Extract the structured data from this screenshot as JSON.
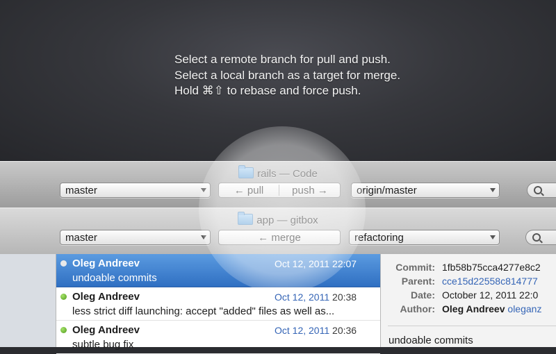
{
  "hint": {
    "line1": "Select a remote branch for pull and push.",
    "line2": "Select a local branch as a target for merge.",
    "line3": "Hold ⌘⇧ to rebase and force push."
  },
  "window1": {
    "title": "rails — Code",
    "local_branch": "master",
    "pull_label": "← pull",
    "push_label": "push →",
    "remote_branch": "origin/master"
  },
  "window2": {
    "title": "app — gitbox",
    "local_branch": "master",
    "merge_label": "← merge",
    "target_branch": "refactoring"
  },
  "commits": [
    {
      "author": "Oleg Andreev",
      "date": "Oct 12, 2011",
      "time": "22:07",
      "message": "undoable commits",
      "status": "selected"
    },
    {
      "author": "Oleg Andreev",
      "date": "Oct 12, 2011",
      "time": "20:38",
      "message": "less strict diff launching: accept \"added\" files as well as...",
      "status": "pushed"
    },
    {
      "author": "Oleg Andreev",
      "date": "Oct 12, 2011",
      "time": "20:36",
      "message": "subtle bug fix",
      "status": "pushed"
    }
  ],
  "details": {
    "commit_label": "Commit:",
    "commit_value": "1fb58b75cca4277e8c2",
    "parent_label": "Parent:",
    "parent_value": "cce15d22558c814777",
    "date_label": "Date:",
    "date_value": "October 12, 2011 22:0",
    "author_label": "Author:",
    "author_name": "Oleg Andreev",
    "author_handle": "oleganz",
    "message": "undoable commits"
  },
  "colors": {
    "selection": "#3b7fd4",
    "link": "#3565b6",
    "status_dot": "#5aa624"
  }
}
